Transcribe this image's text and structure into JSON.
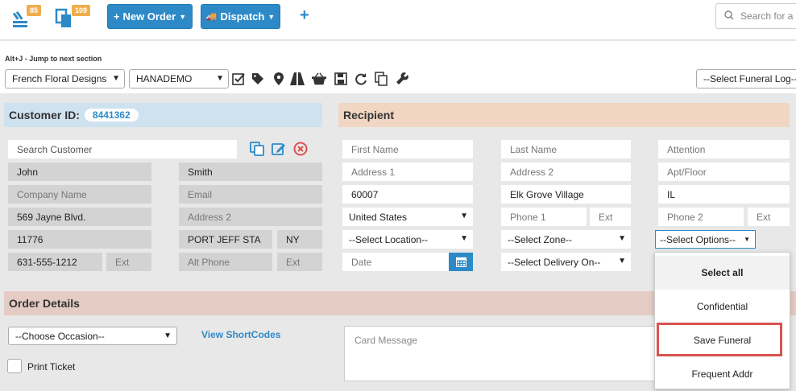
{
  "topbar": {
    "badge1": "85",
    "badge2": "109",
    "new_order_label": "New Order",
    "dispatch_label": "Dispatch",
    "search_placeholder": "Search for a"
  },
  "toolbar": {
    "jump_hint": "Alt+J - Jump to next section",
    "store_select": "French Floral Designs",
    "company_select": "HANADEMO",
    "funeral_log_select": "--Select Funeral Log--",
    "icons": [
      "check-square-icon",
      "tags-icon",
      "map-pin-icon",
      "road-icon",
      "basket-icon",
      "save-icon",
      "refresh-icon",
      "copy-icon",
      "wrench-icon"
    ]
  },
  "customer": {
    "header_label": "Customer ID:",
    "customer_id": "8441362",
    "search_placeholder": "Search Customer",
    "first_name": "John",
    "last_name": "Smith",
    "company_placeholder": "Company Name",
    "email_placeholder": "Email",
    "address1": "569 Jayne Blvd.",
    "address2_placeholder": "Address 2",
    "zip": "11776",
    "city": "PORT JEFF STA",
    "state": "NY",
    "phone": "631-555-1212",
    "ext_placeholder": "Ext",
    "alt_phone_placeholder": "Alt Phone",
    "alt_ext_placeholder": "Ext"
  },
  "recipient": {
    "header_label": "Recipient",
    "first_name_placeholder": "First Name",
    "last_name_placeholder": "Last Name",
    "attention_placeholder": "Attention",
    "address1_placeholder": "Address 1",
    "address2_placeholder": "Address 2",
    "apt_placeholder": "Apt/Floor",
    "zip": "60007",
    "city": "Elk Grove Village",
    "state": "IL",
    "country": "United States",
    "phone1_placeholder": "Phone 1",
    "ext1_placeholder": "Ext",
    "phone2_placeholder": "Phone 2",
    "ext2_placeholder": "Ext",
    "location_select": "--Select Location--",
    "zone_select": "--Select Zone--",
    "options_select": "--Select Options--",
    "date_placeholder": "Date",
    "delivery_select": "--Select Delivery On--"
  },
  "options_dropdown": {
    "items": [
      "Select all",
      "Confidential",
      "Save Funeral",
      "Frequent Addr"
    ]
  },
  "order": {
    "header_label": "Order Details",
    "occasion_select": "--Choose Occasion--",
    "shortcodes_link": "View ShortCodes",
    "card_message_placeholder": "Card Message",
    "print_ticket_label": "Print Ticket"
  },
  "colors": {
    "accent": "#2d8ac7",
    "badge": "#f0ad4e",
    "customer_header_bg": "#cfe2f0",
    "recipient_header_bg": "#f0d6c3",
    "order_header_bg": "#e4cbc3",
    "highlight": "#d9534f"
  }
}
